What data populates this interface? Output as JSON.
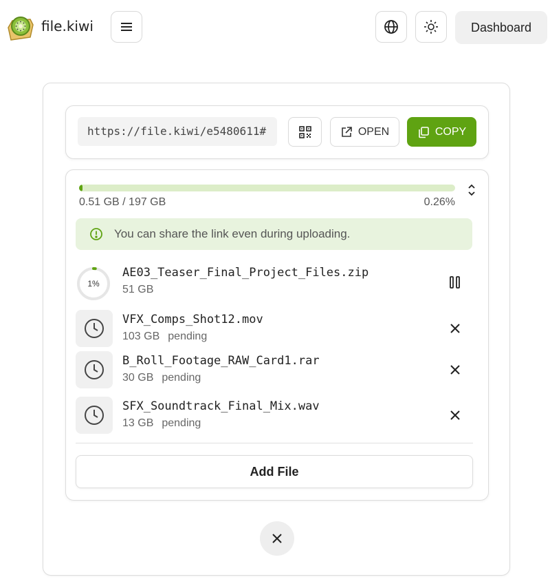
{
  "app": {
    "name": "file.kiwi"
  },
  "header": {
    "menu_icon": "hamburger-icon",
    "language_icon": "globe-icon",
    "theme_icon": "sun-icon",
    "dashboard_label": "Dashboard"
  },
  "share": {
    "url": "https://file.kiwi/e5480611#",
    "qr_icon": "qr-code-icon",
    "open_label": "OPEN",
    "copy_label": "COPY"
  },
  "upload": {
    "progress_fraction": 0.0026,
    "progress_text": "0.51 GB / 197 GB",
    "progress_percent": "0.26%",
    "notice": "You can share the link even during uploading.",
    "files": [
      {
        "name": "AE03_Teaser_Final_Project_Files.zip",
        "size": "51 GB",
        "status": "",
        "percent_label": "1%",
        "percent": 0.01,
        "action": "pause-icon"
      },
      {
        "name": "VFX_Comps_Shot12.mov",
        "size": "103 GB",
        "status": "pending",
        "action": "close-icon"
      },
      {
        "name": "B_Roll_Footage_RAW_Card1.rar",
        "size": "30 GB",
        "status": "pending",
        "action": "close-icon"
      },
      {
        "name": "SFX_Soundtrack_Final_Mix.wav",
        "size": "13 GB",
        "status": "pending",
        "action": "close-icon"
      }
    ],
    "add_file_label": "Add File"
  },
  "colors": {
    "accent": "#5fa312",
    "notice_bg": "#e8f3de",
    "track": "#dcedc8"
  }
}
